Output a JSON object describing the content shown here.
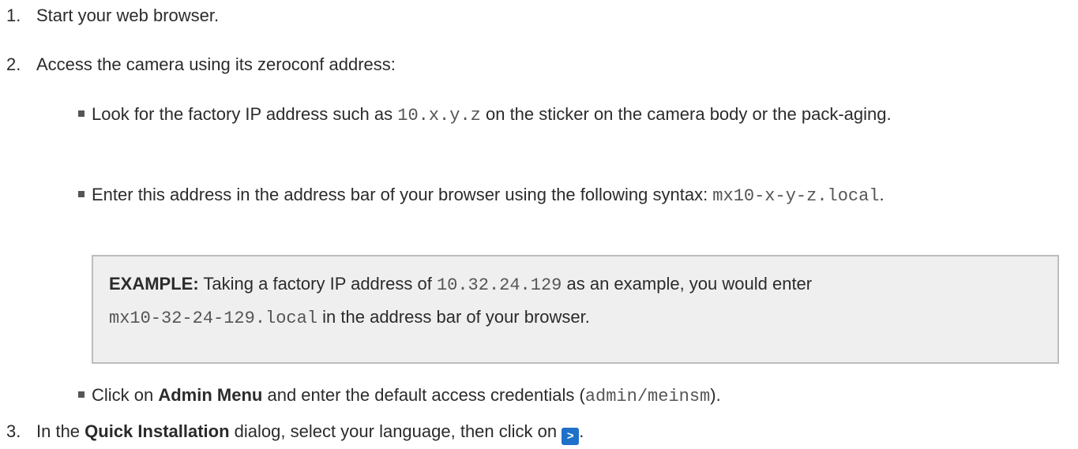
{
  "steps": [
    {
      "num": "1.",
      "text": "Start your web browser."
    },
    {
      "num": "2.",
      "text": "Access the camera using its zeroconf address:"
    },
    {
      "num": "3.",
      "pre": "In the ",
      "bold": "Quick Installation",
      "post": " dialog, select your language, then click on ",
      "end": ".",
      "button_glyph": ">"
    }
  ],
  "bullets": {
    "look": {
      "pre": "Look for the factory IP address such as ",
      "code": "10.x.y.z",
      "post": " on the sticker on the camera body or the pack-aging."
    },
    "enter": {
      "pre": "Enter this address in the address bar of your browser using the following syntax: ",
      "code": "mx10-x-y-z.local",
      "post": "."
    },
    "click": {
      "pre": "Click on ",
      "bold": "Admin Menu",
      "mid": " and enter the default access credentials (",
      "code": "admin/meinsm",
      "post": ")."
    }
  },
  "example": {
    "label": "EXAMPLE:",
    "pre": " Taking a factory IP address of ",
    "code1": "10.32.24.129",
    "mid": " as an example, you would enter ",
    "code2": "mx10-32-24-129.local",
    "post": " in the address bar of your browser."
  },
  "colors": {
    "text": "#2b2b2b",
    "code": "#555555",
    "example_bg": "#efefef",
    "example_border": "#bdbdbd",
    "button": "#1e70c8"
  },
  "icons": {
    "bullet": "square-bullet-icon",
    "button": "next-arrow-icon"
  }
}
